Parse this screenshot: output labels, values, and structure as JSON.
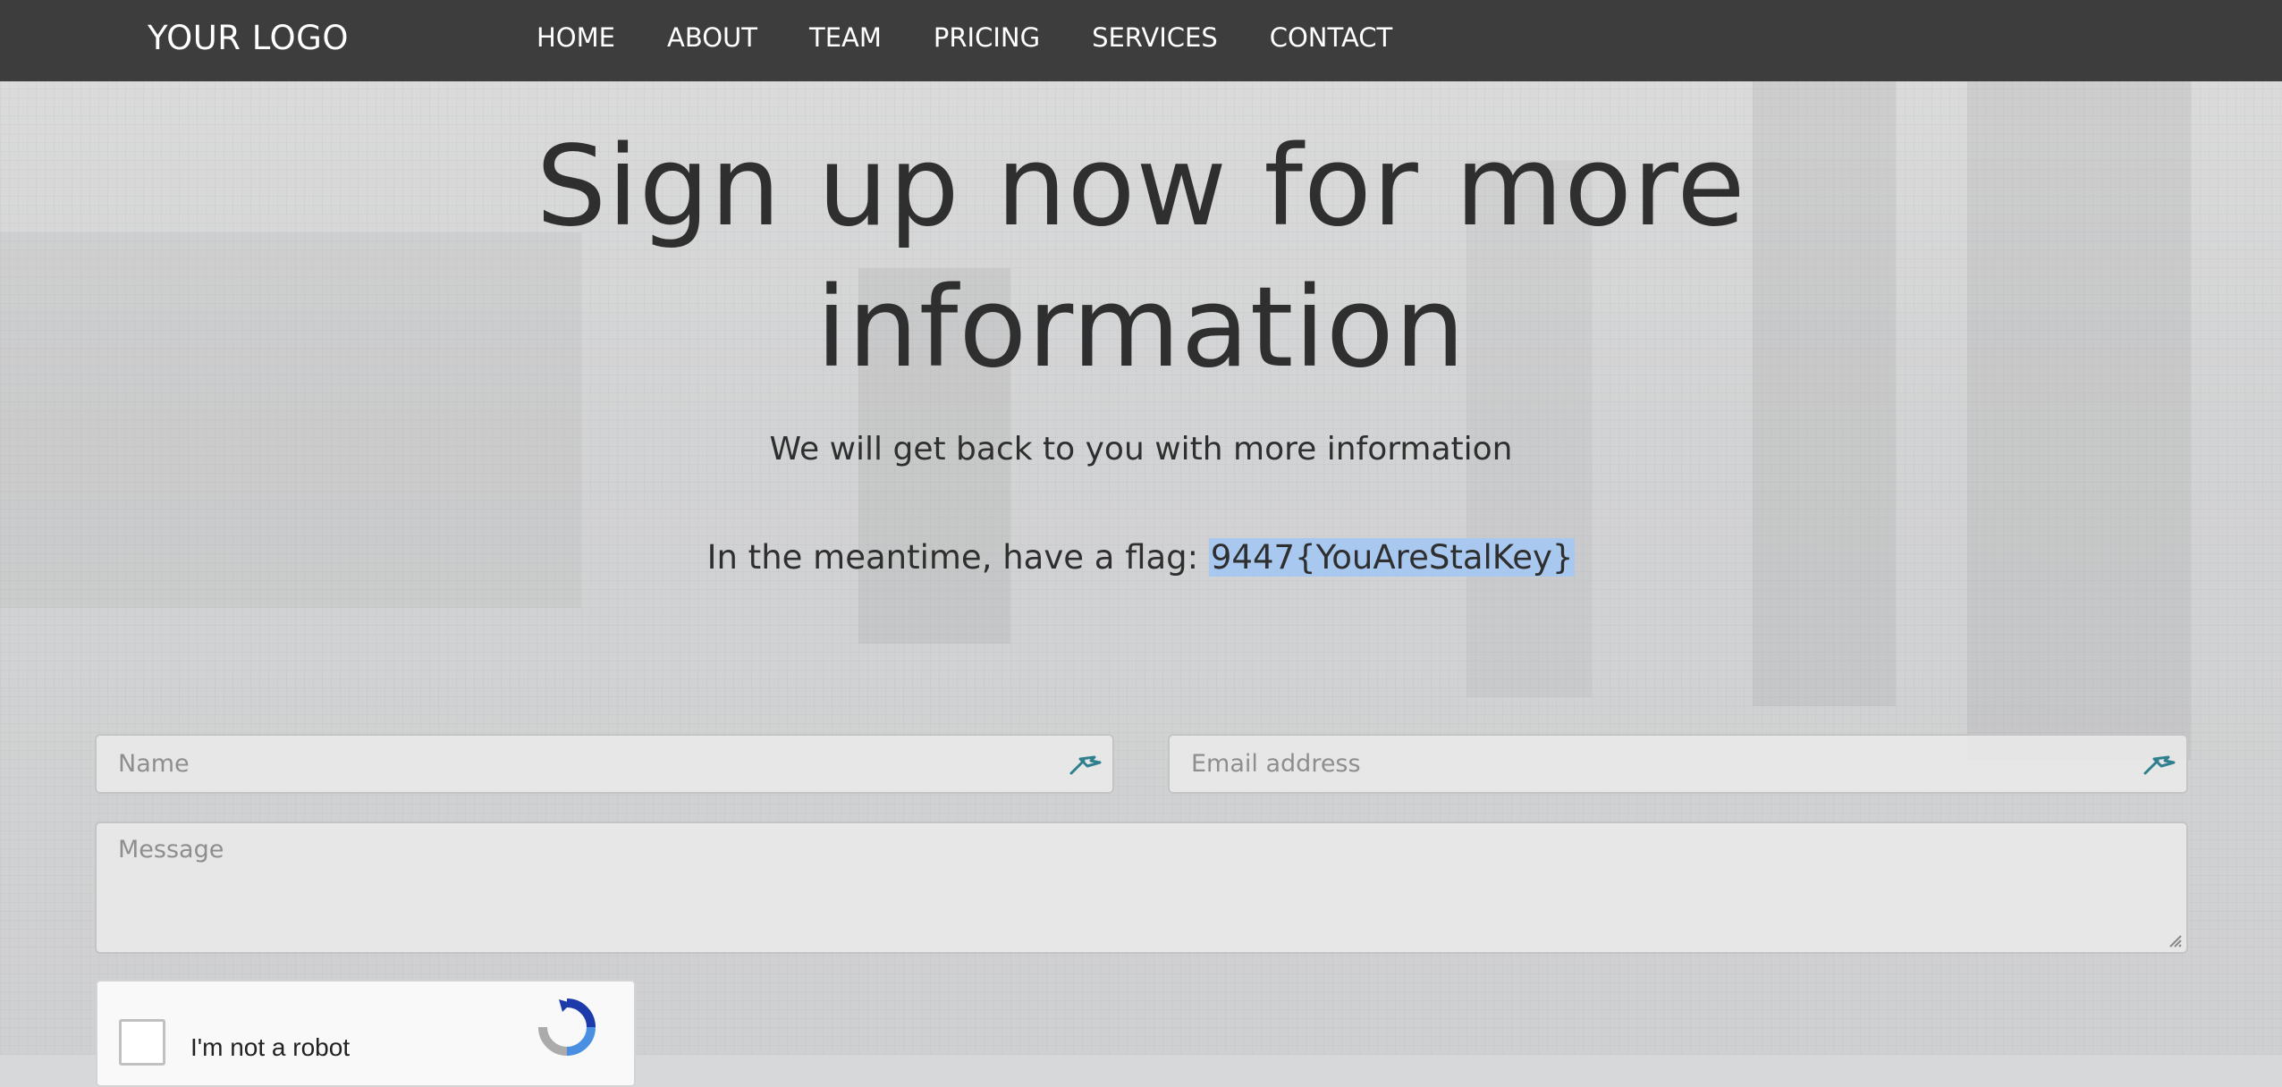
{
  "nav": {
    "logo": "YOUR LOGO",
    "items": [
      {
        "label": "HOME"
      },
      {
        "label": "ABOUT"
      },
      {
        "label": "TEAM"
      },
      {
        "label": "PRICING"
      },
      {
        "label": "SERVICES"
      },
      {
        "label": "CONTACT"
      }
    ]
  },
  "hero": {
    "title_line1": "Sign up now for more",
    "title_line2": "information",
    "subtitle": "We will get back to you with more information",
    "flag_prefix": "In the meantime, have a flag: ",
    "flag_value": "9447{YouAreStalKey}"
  },
  "form": {
    "name_placeholder": "Name",
    "email_placeholder": "Email address",
    "message_placeholder": "Message",
    "recaptcha_label": "I'm not a robot"
  },
  "colors": {
    "nav_bg": "#3d3d3d",
    "flag_highlight": "#a8c8ef",
    "key_icon": "#2f7f8f"
  },
  "icons": {
    "field_key": "password-manager-key-icon",
    "captcha": "recaptcha-logo-icon"
  }
}
